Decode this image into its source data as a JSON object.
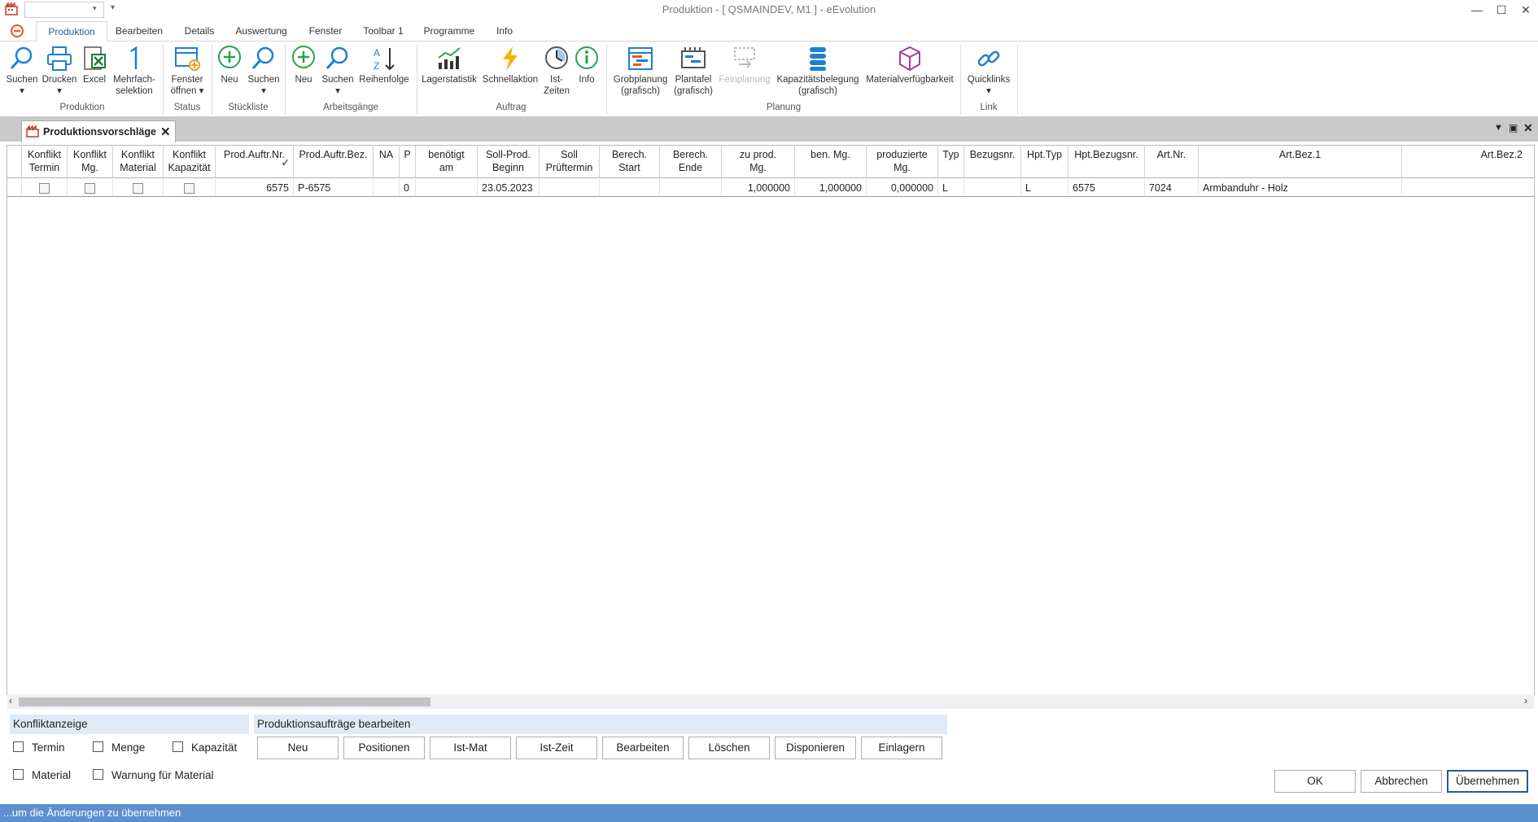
{
  "window": {
    "title": "Produktion - [ QSMAINDEV, M1 ]  -  eEvolution",
    "controls": [
      "—",
      "☐",
      "✕"
    ]
  },
  "menu": {
    "tabs": [
      "Produktion",
      "Bearbeiten",
      "Details",
      "Auswertung",
      "Fenster",
      "Toolbar 1",
      "Programme",
      "Info"
    ]
  },
  "ribbon": {
    "groups": {
      "produktion": "Produktion",
      "status": "Status",
      "stueckliste": "Stückliste",
      "arbeitsgaenge": "Arbeitsgänge",
      "auftrag": "Auftrag",
      "planung": "Planung",
      "link": "Link"
    },
    "buttons": {
      "suchen1": "Suchen",
      "drucken": "Drucken",
      "excel": "Excel",
      "mehrfach1": "Mehrfach-",
      "mehrfach2": "selektion",
      "fenster1": "Fenster",
      "fenster2": "öffnen",
      "neu1": "Neu",
      "suchen2": "Suchen",
      "neu2": "Neu",
      "suchen3": "Suchen",
      "reihenfolge": "Reihenfolge",
      "lagerstatistik": "Lagerstatistik",
      "schnellaktion": "Schnellaktion",
      "istzeiten1": "Ist-",
      "istzeiten2": "Zeiten",
      "info": "Info",
      "grob1": "Grobplanung",
      "grob2": "(grafisch)",
      "plan1": "Plantafel",
      "plan2": "(grafisch)",
      "feinplanung": "Feinplanung",
      "kap1": "Kapazitätsbelegung",
      "kap2": "(grafisch)",
      "materialverfuegbarkeit": "Materialverfügbarkeit",
      "quicklinks": "Quicklinks"
    }
  },
  "document": {
    "tab_title": "Produktionsvorschläge"
  },
  "grid": {
    "headers": {
      "konflikt_termin": [
        "Konflikt",
        "Termin"
      ],
      "konflikt_mg": [
        "Konflikt",
        "Mg."
      ],
      "konflikt_material": [
        "Konflikt",
        "Material"
      ],
      "konflikt_kapazitaet": [
        "Konflikt",
        "Kapazität"
      ],
      "prod_auftr_nr": "Prod.Auftr.Nr.",
      "prod_auftr_bez": "Prod.Auftr.Bez.",
      "na": "NA",
      "p": "P",
      "benoetigt_am": [
        "benötigt",
        "am"
      ],
      "soll_prod_beginn": [
        "Soll-Prod.",
        "Beginn"
      ],
      "soll_prueftermin": [
        "Soll",
        "Prüftermin"
      ],
      "berech_start": [
        "Berech.",
        "Start"
      ],
      "berech_ende": [
        "Berech.",
        "Ende"
      ],
      "zu_prod_mg": [
        "zu prod.",
        "Mg."
      ],
      "ben_mg": "ben. Mg.",
      "produzierte_mg": [
        "produzierte",
        "Mg."
      ],
      "typ": "Typ",
      "bezugsnr": "Bezugsnr.",
      "hpt_typ": "Hpt.Typ",
      "hpt_bezugsnr": "Hpt.Bezugsnr.",
      "art_nr": "Art.Nr.",
      "art_bez1": "Art.Bez.1",
      "art_bez2": "Art.Bez.2"
    },
    "rows": [
      {
        "prod_auftr_nr": "6575",
        "prod_auftr_bez": "P-6575",
        "na": "",
        "p": "0",
        "benoetigt_am": "",
        "soll_prod_beginn": "23.05.2023",
        "soll_prueftermin": "",
        "berech_start": "",
        "berech_ende": "",
        "zu_prod_mg": "1,000000",
        "ben_mg": "1,000000",
        "produzierte_mg": "0,000000",
        "typ": "L",
        "bezugsnr": "",
        "hpt_typ": "L",
        "hpt_bezugsnr": "6575",
        "art_nr": "7024",
        "art_bez1": "Armbanduhr - Holz",
        "art_bez2": ""
      }
    ]
  },
  "konfliktanzeige": {
    "title": "Konfliktanzeige",
    "checks": [
      "Termin",
      "Menge",
      "Kapazität",
      "Material",
      "Warnung für Material"
    ]
  },
  "bearbeiten_panel": {
    "title": "Produktionsaufträge bearbeiten",
    "buttons": [
      "Neu",
      "Positionen",
      "Ist-Mat",
      "Ist-Zeit",
      "Bearbeiten",
      "Löschen",
      "Disponieren",
      "Einlagern"
    ]
  },
  "dialog_buttons": {
    "ok": "OK",
    "abbrechen": "Abbrechen",
    "uebernehmen": "Übernehmen"
  },
  "status": {
    "text": "...um die Änderungen zu übernehmen"
  },
  "colors": {
    "accent": "#2b579a",
    "status_bar": "#5b8fd0",
    "panel_header": "#deebf7",
    "tab_strip": "#c9c9c9"
  }
}
